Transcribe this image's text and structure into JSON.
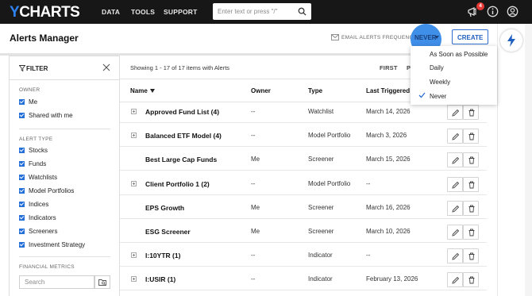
{
  "brand": {
    "logo_y": "Y",
    "logo_rest": "CHARTS",
    "accent": "#2f82f0"
  },
  "topnav": {
    "items": [
      {
        "label": "DATA"
      },
      {
        "label": "TOOLS"
      },
      {
        "label": "SUPPORT"
      }
    ],
    "search_placeholder": "Enter text or press \"/\"",
    "notification_count": "4"
  },
  "page": {
    "title": "Alerts Manager",
    "email_freq_label": "EMAIL ALERTS FREQUENCY:",
    "email_freq_value": "NEVER",
    "create_label": "CREATE"
  },
  "dropdown": {
    "options": [
      {
        "label": "As Soon as Possible",
        "selected": false
      },
      {
        "label": "Daily",
        "selected": false
      },
      {
        "label": "Weekly",
        "selected": false
      },
      {
        "label": "Never",
        "selected": true
      }
    ]
  },
  "sidebar": {
    "title": "FILTER",
    "owner": {
      "heading": "OWNER",
      "items": [
        {
          "label": "Me",
          "checked": true
        },
        {
          "label": "Shared with me",
          "checked": true
        }
      ]
    },
    "alert_type": {
      "heading": "ALERT TYPE",
      "items": [
        {
          "label": "Stocks",
          "checked": true
        },
        {
          "label": "Funds",
          "checked": true
        },
        {
          "label": "Watchlists",
          "checked": true
        },
        {
          "label": "Model Portfolios",
          "checked": true
        },
        {
          "label": "Indices",
          "checked": true
        },
        {
          "label": "Indicators",
          "checked": true
        },
        {
          "label": "Screeners",
          "checked": true
        },
        {
          "label": "Investment Strategy",
          "checked": true
        }
      ]
    },
    "financial_metrics": {
      "heading": "FINANCIAL METRICS",
      "search_placeholder": "Search"
    }
  },
  "table": {
    "showing": "Showing 1 - 17 of 17 items with Alerts",
    "pagination": {
      "first": "FIRST",
      "prev": "P"
    },
    "columns": {
      "name": "Name",
      "owner": "Owner",
      "type": "Type",
      "last_triggered": "Last Triggered"
    },
    "rows": [
      {
        "name": "Approved Fund List (4)",
        "owner": "--",
        "type": "Watchlist",
        "last": "March 14, 2026",
        "expandable": true
      },
      {
        "name": "Balanced ETF Model (4)",
        "owner": "--",
        "type": "Model Portfolio",
        "last": "March 3, 2026",
        "expandable": true
      },
      {
        "name": "Best Large Cap Funds",
        "owner": "Me",
        "type": "Screener",
        "last": "March 15, 2026",
        "expandable": false
      },
      {
        "name": "Client Portfolio 1 (2)",
        "owner": "--",
        "type": "Model Portfolio",
        "last": "--",
        "expandable": true
      },
      {
        "name": "EPS Growth",
        "owner": "Me",
        "type": "Screener",
        "last": "March 16, 2026",
        "expandable": false
      },
      {
        "name": "ESG Screener",
        "owner": "Me",
        "type": "Screener",
        "last": "March 10, 2026",
        "expandable": false
      },
      {
        "name": "I:10YTR (1)",
        "owner": "--",
        "type": "Indicator",
        "last": "--",
        "expandable": true
      },
      {
        "name": "I:USIR (1)",
        "owner": "--",
        "type": "Indicator",
        "last": "February 13, 2026",
        "expandable": true
      }
    ]
  }
}
